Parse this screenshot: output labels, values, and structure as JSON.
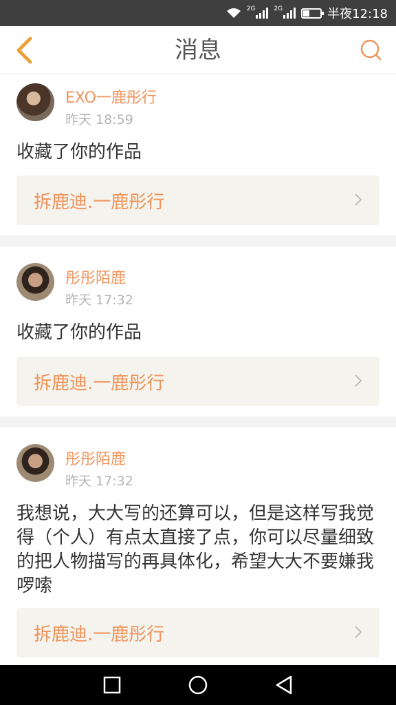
{
  "status_bar": {
    "net1": "2G",
    "net2": "2G",
    "time": "半夜12:18"
  },
  "header": {
    "title": "消息"
  },
  "colors": {
    "accent": "#f0935a",
    "header_text": "#555555",
    "link_bg": "#f4f3ed"
  },
  "messages": [
    {
      "username": "EXO一鹿彤行",
      "time": "昨天 18:59",
      "text": "收藏了你的作品",
      "work_title": "拆鹿迪.一鹿彤行"
    },
    {
      "username": "彤彤陌鹿",
      "time": "昨天 17:32",
      "text": "收藏了你的作品",
      "work_title": "拆鹿迪.一鹿彤行"
    },
    {
      "username": "彤彤陌鹿",
      "time": "昨天 17:32",
      "text": "我想说，大大写的还算可以，但是这样写我觉得（个人）有点太直接了点，你可以尽量细致的把人物描写的再具体化，希望大大不要嫌我啰嗦",
      "work_title": "拆鹿迪.一鹿彤行"
    }
  ],
  "icons": {
    "back": "chevron-left-icon",
    "search": "search-icon",
    "nav_recent": "square-icon",
    "nav_home": "circle-icon",
    "nav_back": "triangle-back-icon"
  }
}
